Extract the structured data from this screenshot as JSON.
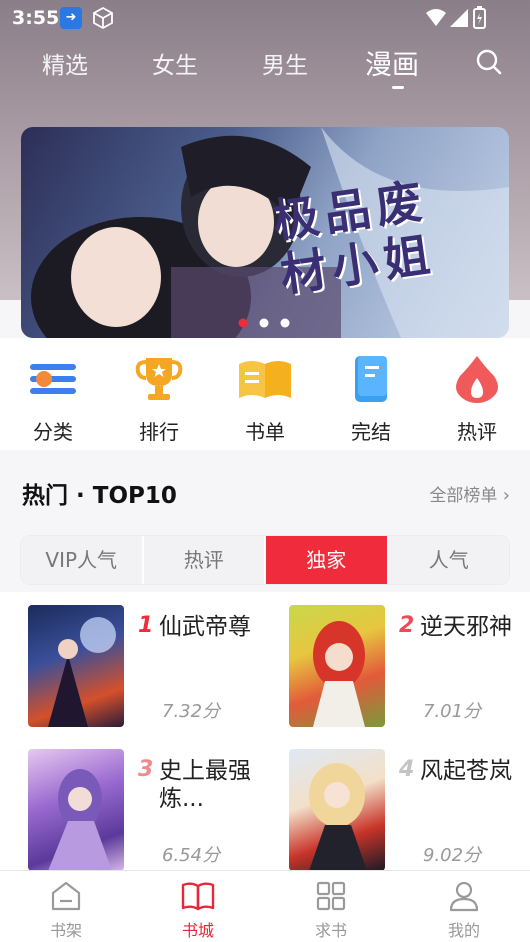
{
  "status": {
    "time": "3:55"
  },
  "top_tabs": [
    "精选",
    "女生",
    "男生",
    "漫画"
  ],
  "active_top_tab": "漫画",
  "banner": {
    "title": "极品废材小姐",
    "dot_count": 3,
    "active_dot": 0
  },
  "quick": [
    {
      "label": "分类",
      "icon": "category-icon"
    },
    {
      "label": "排行",
      "icon": "trophy-icon"
    },
    {
      "label": "书单",
      "icon": "booklist-icon"
    },
    {
      "label": "完结",
      "icon": "finished-book-icon"
    },
    {
      "label": "热评",
      "icon": "flame-icon"
    }
  ],
  "section": {
    "title": "热门 · TOP10",
    "more": "全部榜单"
  },
  "segments": [
    "VIP人气",
    "热评",
    "独家",
    "人气"
  ],
  "active_segment": "独家",
  "ranking": [
    {
      "rank": "1",
      "title": "仙武帝尊",
      "score": "7.32分"
    },
    {
      "rank": "2",
      "title": "逆天邪神",
      "score": "7.01分"
    },
    {
      "rank": "3",
      "title": "史上最强炼...",
      "score": "6.54分"
    },
    {
      "rank": "4",
      "title": "风起苍岚",
      "score": "9.02分"
    }
  ],
  "tabbar": [
    {
      "label": "书架",
      "icon": "bookshelf-icon"
    },
    {
      "label": "书城",
      "icon": "bookstore-icon"
    },
    {
      "label": "求书",
      "icon": "request-grid-icon"
    },
    {
      "label": "我的",
      "icon": "profile-icon"
    }
  ],
  "active_tabbar": "书城",
  "colors": {
    "accent": "#ef2b3c",
    "rank1": "#ef2b3c",
    "rank2": "#ef4a55",
    "rank3": "#f08a8a",
    "rank4": "#c4c4c4"
  }
}
